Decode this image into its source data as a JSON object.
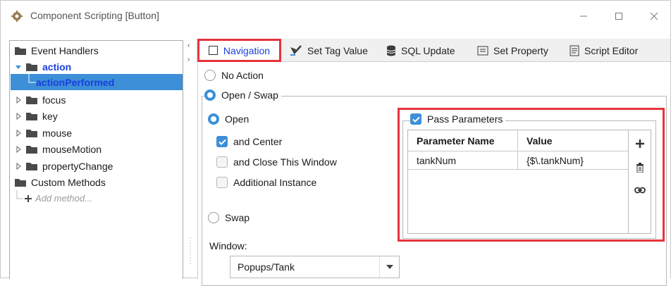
{
  "window": {
    "title": "Component Scripting [Button]",
    "minimize_icon": "minimize-icon",
    "maximize_icon": "maximize-icon",
    "close_icon": "close-icon"
  },
  "tree": {
    "event_handlers": "Event Handlers",
    "action": "action",
    "action_performed": "actionPerformed",
    "items": [
      "focus",
      "key",
      "mouse",
      "mouseMotion",
      "propertyChange"
    ],
    "custom_methods": "Custom Methods",
    "add_method": "Add method..."
  },
  "tabs": {
    "navigation": "Navigation",
    "set_tag_value": "Set Tag Value",
    "sql_update": "SQL Update",
    "set_property": "Set Property",
    "script_editor": "Script Editor"
  },
  "navigation": {
    "no_action": "No Action",
    "open_swap": "Open / Swap",
    "open": "Open",
    "and_center": "and Center",
    "and_center_checked": true,
    "and_close": "and Close This Window",
    "and_close_checked": false,
    "additional_instance": "Additional Instance",
    "additional_instance_checked": false,
    "swap": "Swap",
    "window_label": "Window:",
    "window_value": "Popups/Tank"
  },
  "parameters": {
    "pass_parameters": "Pass Parameters",
    "pass_parameters_checked": true,
    "columns": [
      "Parameter Name",
      "Value"
    ],
    "rows": [
      [
        "tankNum",
        "{$\\.tankNum}"
      ]
    ]
  },
  "colors": {
    "accent": "#3d8fd8",
    "highlight": "#e5343c",
    "link_blue": "#1a3fdc"
  }
}
